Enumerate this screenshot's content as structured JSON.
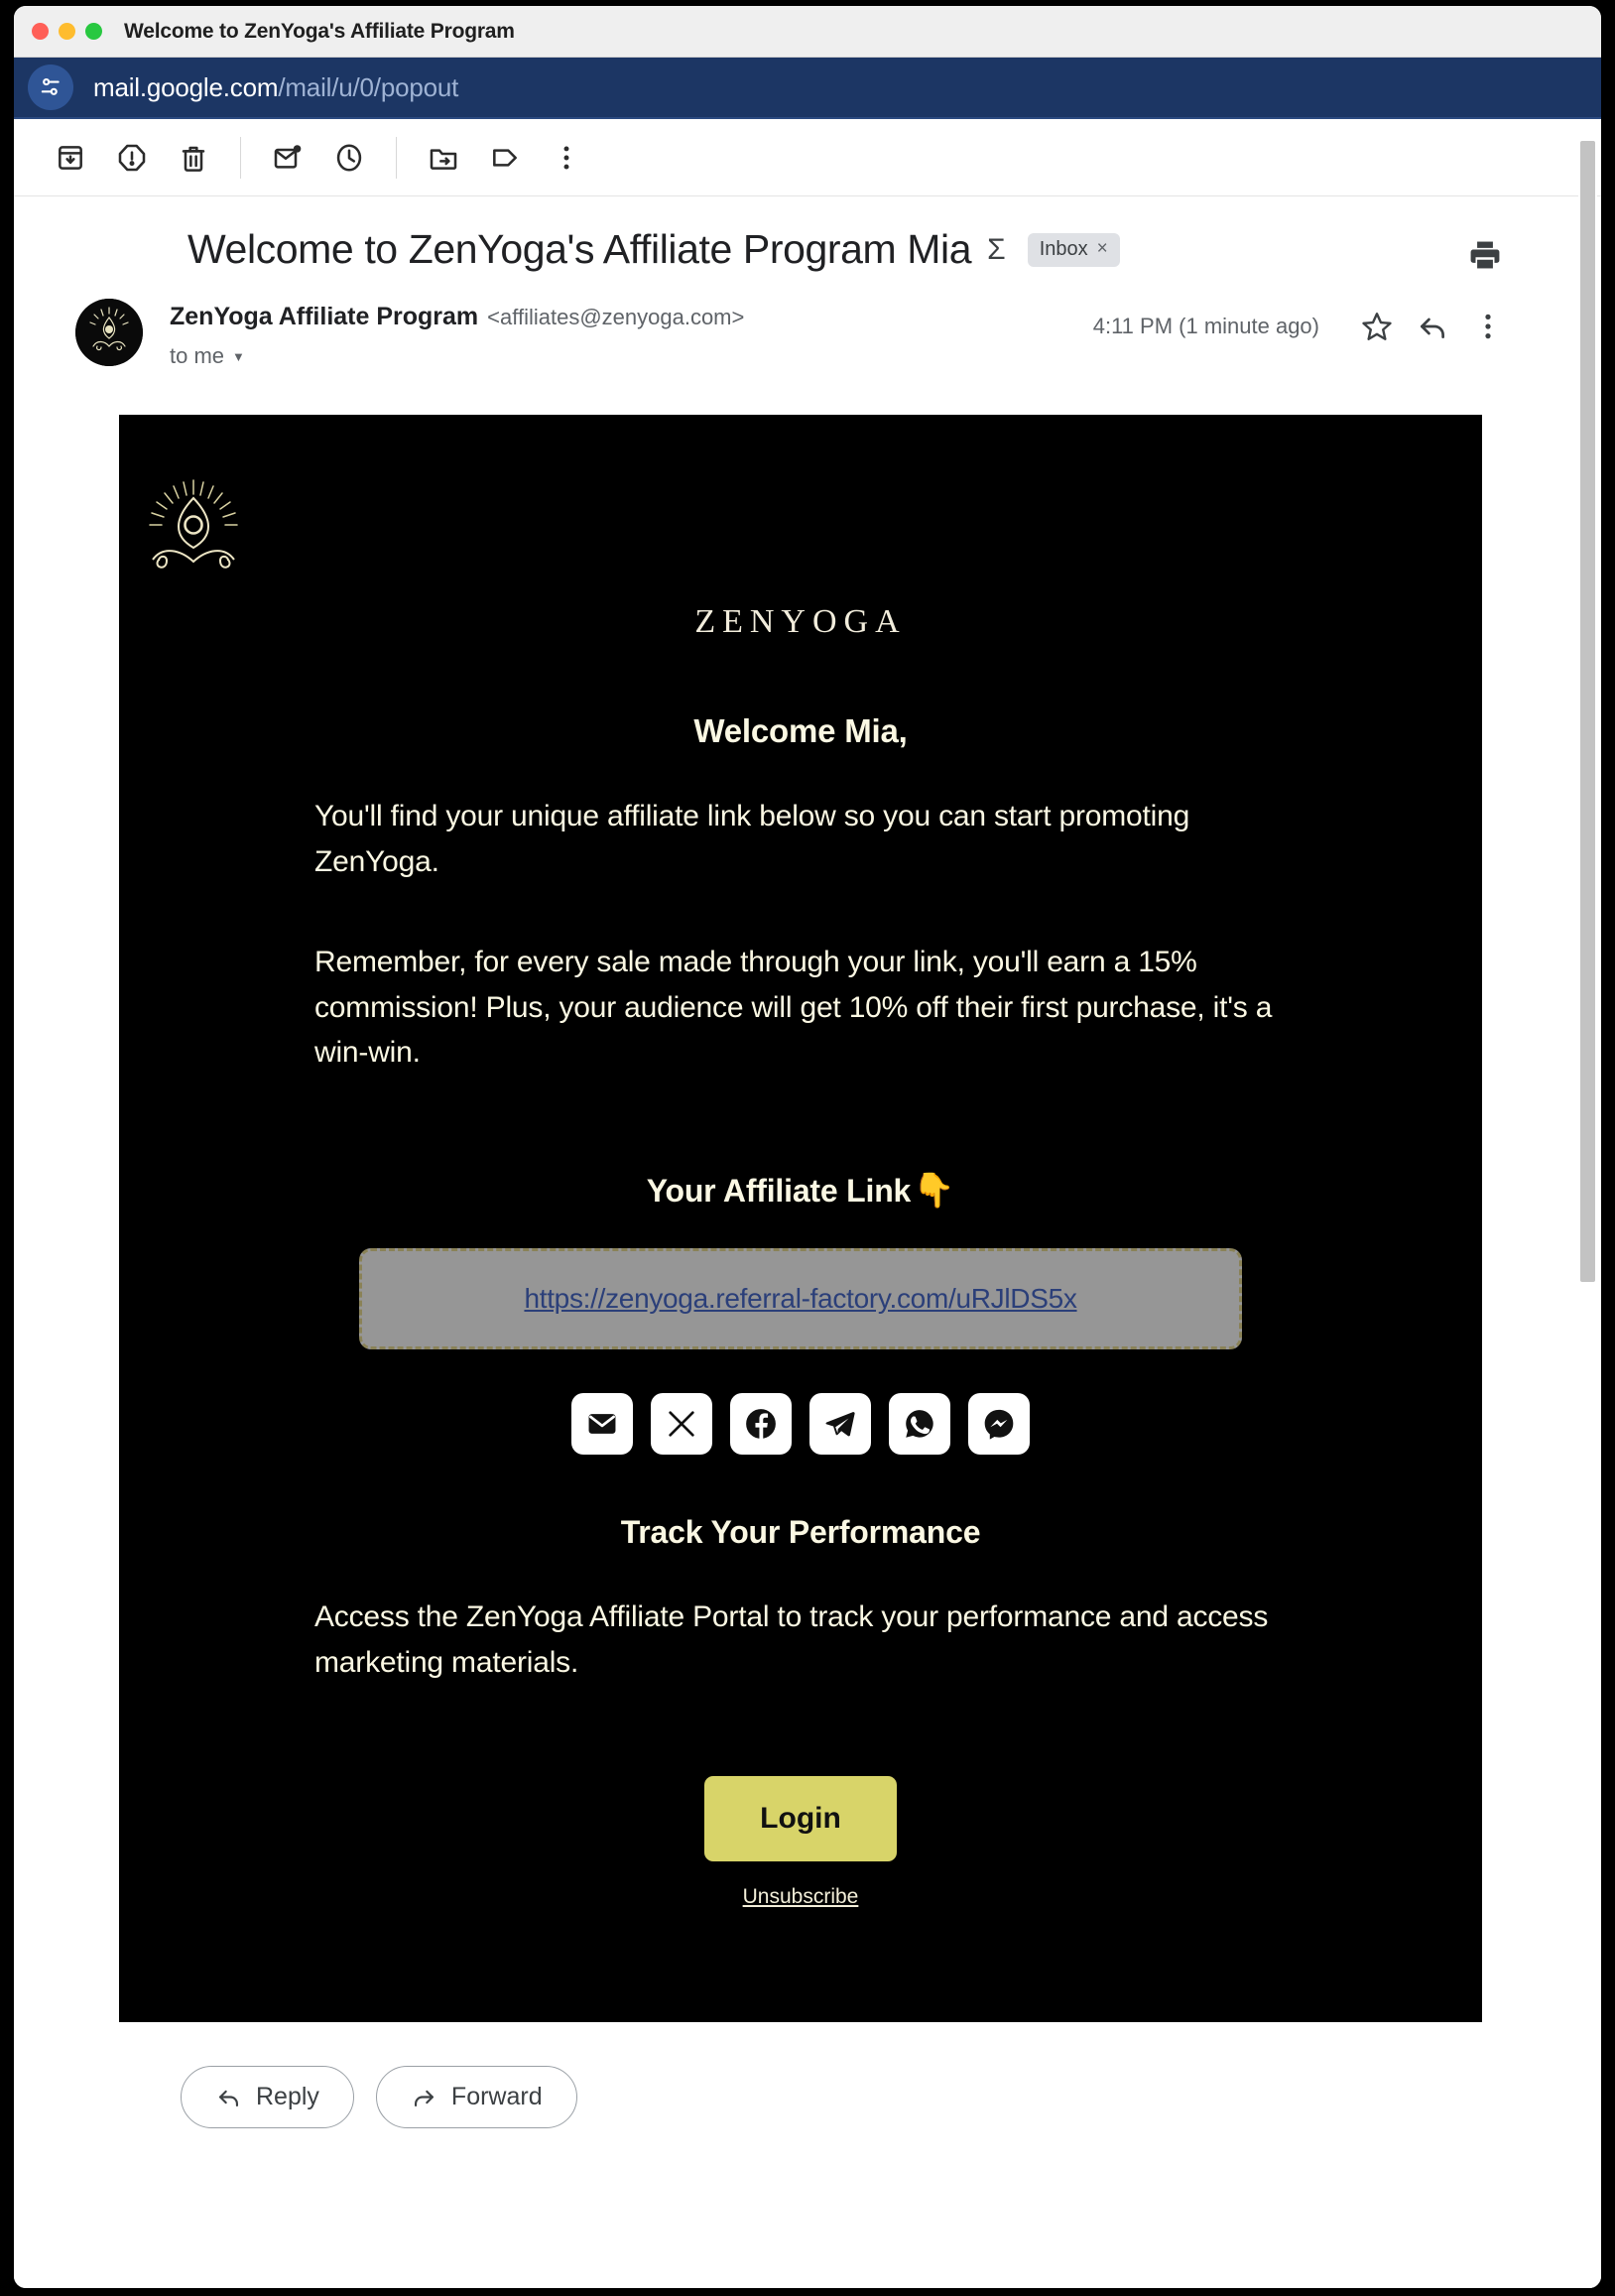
{
  "window": {
    "title": "Welcome to ZenYoga's Affiliate Program"
  },
  "urlbar": {
    "host": "mail.google.com",
    "path": "/mail/u/0/popout",
    "site_icon": "site-settings-icon"
  },
  "toolbar": {
    "items": [
      {
        "name": "archive-icon",
        "label": "Archive"
      },
      {
        "name": "report-spam-icon",
        "label": "Report spam"
      },
      {
        "name": "delete-icon",
        "label": "Delete"
      },
      {
        "name": "mark-unread-icon",
        "label": "Mark as unread"
      },
      {
        "name": "snooze-icon",
        "label": "Snooze"
      },
      {
        "name": "move-to-icon",
        "label": "Move to"
      },
      {
        "name": "label-icon",
        "label": "Labels"
      },
      {
        "name": "more-options-icon",
        "label": "More"
      }
    ]
  },
  "message": {
    "subject": "Welcome to ZenYoga's Affiliate Program Mia",
    "sigma_glyph": "Σ",
    "inbox_label": "Inbox",
    "inbox_close": "×",
    "print_label": "Print all",
    "sender_name": "ZenYoga Affiliate Program",
    "sender_email": "<affiliates@zenyoga.com>",
    "recipient": "to me",
    "timestamp": "4:11 PM (1 minute ago)"
  },
  "email": {
    "brand": "ZENYOGA",
    "welcome_heading": "Welcome Mia,",
    "paragraph_1": "You'll find your unique affiliate link below so you can start promoting ZenYoga.",
    "paragraph_2": "Remember, for every sale made through your link, you'll earn a 15% commission! Plus, your audience will get 10% off their first purchase, it's a win-win.",
    "affiliate_heading": "Your Affiliate Link",
    "affiliate_heading_emoji": "👇",
    "affiliate_link": "https://zenyoga.referral-factory.com/uRJlDS5x",
    "social_buttons": [
      {
        "name": "email-share-icon",
        "label": "Email"
      },
      {
        "name": "x-twitter-share-icon",
        "label": "X"
      },
      {
        "name": "facebook-share-icon",
        "label": "Facebook"
      },
      {
        "name": "telegram-share-icon",
        "label": "Telegram"
      },
      {
        "name": "whatsapp-share-icon",
        "label": "WhatsApp"
      },
      {
        "name": "messenger-share-icon",
        "label": "Messenger"
      }
    ],
    "track_heading": "Track Your Performance",
    "track_paragraph": "Access the ZenYoga Affiliate Portal to track your performance and access marketing materials.",
    "login_button": "Login",
    "unsubscribe": "Unsubscribe",
    "colors": {
      "background": "#000000",
      "text": "#fbf8e3",
      "accent": "#d8d469",
      "link": "#2b3f79",
      "link_box_bg": "#969696"
    }
  },
  "footer": {
    "reply": "Reply",
    "forward": "Forward"
  }
}
